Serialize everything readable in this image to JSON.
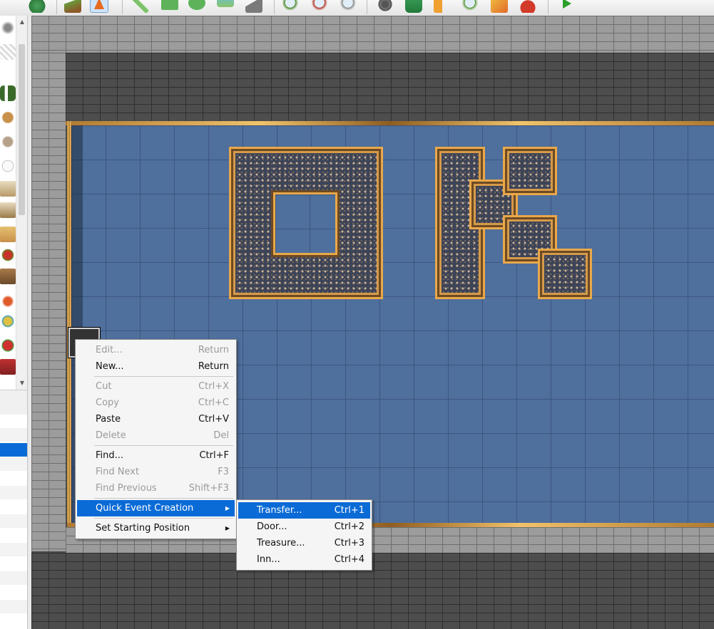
{
  "toolbar": {
    "icons": [
      "undo-icon",
      "map-layer-icon",
      "event-layer-icon",
      "pencil-icon",
      "rectangle-icon",
      "ellipse-icon",
      "fill-icon",
      "shadow-pen-icon",
      "zoom-in-icon",
      "zoom-out-icon",
      "zoom-actual-icon",
      "database-icon",
      "plugin-icon",
      "sound-test-icon",
      "event-search-icon",
      "resource-manager-icon",
      "character-generator-icon",
      "playtest-icon"
    ],
    "active": "event-layer-icon"
  },
  "context_menu": {
    "items": [
      {
        "label": "Edit...",
        "shortcut": "Return",
        "enabled": false
      },
      {
        "label": "New...",
        "shortcut": "Return",
        "enabled": true
      },
      {
        "separator": true
      },
      {
        "label": "Cut",
        "shortcut": "Ctrl+X",
        "enabled": false
      },
      {
        "label": "Copy",
        "shortcut": "Ctrl+C",
        "enabled": false
      },
      {
        "label": "Paste",
        "shortcut": "Ctrl+V",
        "enabled": true
      },
      {
        "label": "Delete",
        "shortcut": "Del",
        "enabled": false
      },
      {
        "separator": true
      },
      {
        "label": "Find...",
        "shortcut": "Ctrl+F",
        "enabled": true
      },
      {
        "label": "Find Next",
        "shortcut": "F3",
        "enabled": false
      },
      {
        "label": "Find Previous",
        "shortcut": "Shift+F3",
        "enabled": false
      },
      {
        "separator": true
      },
      {
        "label": "Quick Event Creation",
        "submenu": true,
        "highlighted": true,
        "enabled": true
      },
      {
        "separator": true
      },
      {
        "label": "Set Starting Position",
        "submenu": true,
        "enabled": true
      }
    ]
  },
  "submenu": {
    "items": [
      {
        "label": "Transfer...",
        "shortcut": "Ctrl+1",
        "highlighted": true
      },
      {
        "label": "Door...",
        "shortcut": "Ctrl+2"
      },
      {
        "label": "Treasure...",
        "shortcut": "Ctrl+3"
      },
      {
        "label": "Inn...",
        "shortcut": "Ctrl+4"
      }
    ]
  },
  "colors": {
    "highlight": "#0b6bd6",
    "floor": "#4f6f9c",
    "carpet_border": "#e9a84a"
  }
}
